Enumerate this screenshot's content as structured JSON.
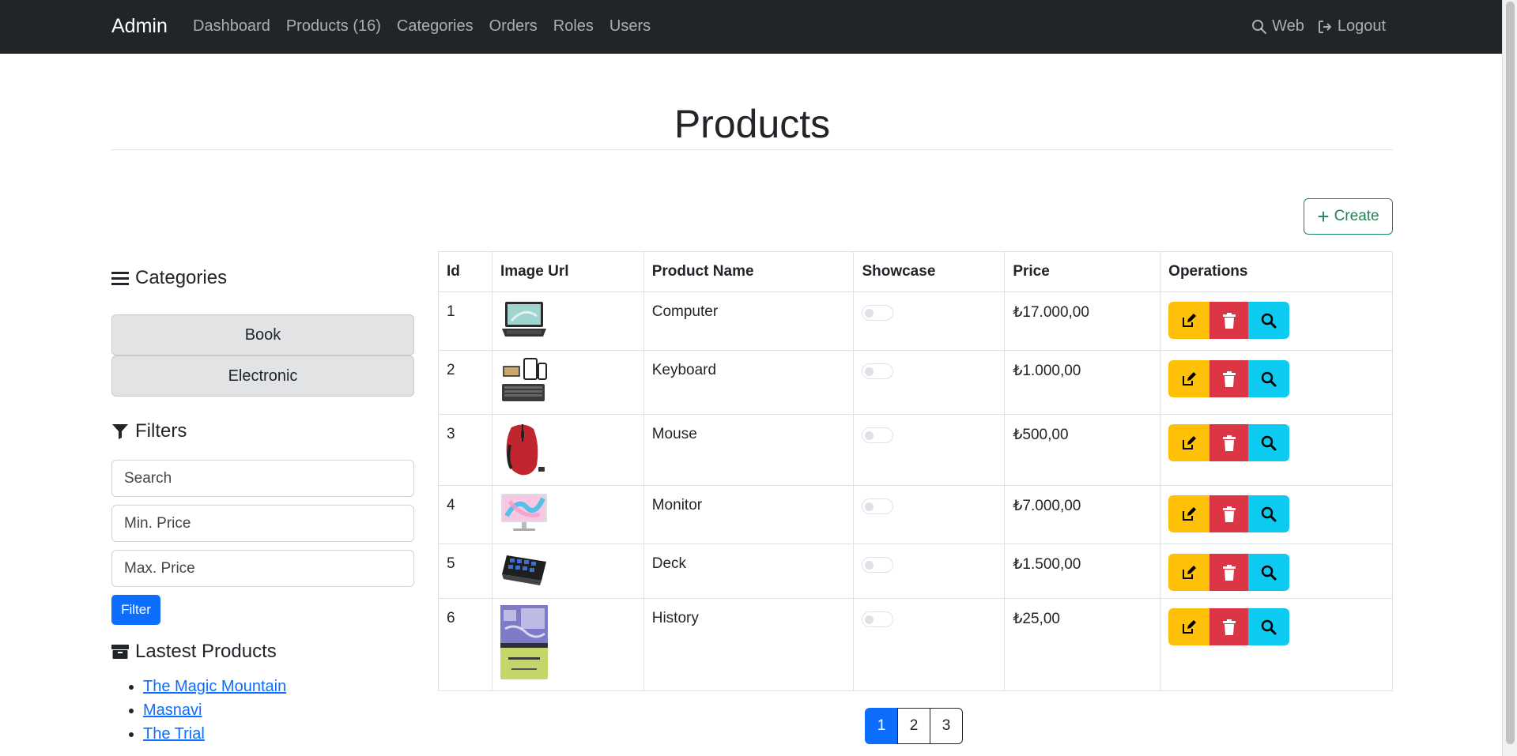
{
  "navbar": {
    "brand": "Admin",
    "links": [
      "Dashboard",
      "Products (16)",
      "Categories",
      "Orders",
      "Roles",
      "Users"
    ],
    "web_label": "Web",
    "logout_label": "Logout"
  },
  "page": {
    "title": "Products",
    "create_label": "Create"
  },
  "sidebar": {
    "categories_heading": "Categories",
    "categories": [
      "Book",
      "Electronic"
    ],
    "filters_heading": "Filters",
    "search_placeholder": "Search",
    "min_price_placeholder": "Min. Price",
    "max_price_placeholder": "Max. Price",
    "filter_button": "Filter",
    "latest_heading": "Lastest Products",
    "latest_products": [
      "The Magic Mountain",
      "Masnavi",
      "The Trial"
    ]
  },
  "table": {
    "headers": [
      "Id",
      "Image Url",
      "Product Name",
      "Showcase",
      "Price",
      "Operations"
    ],
    "rows": [
      {
        "id": "1",
        "name": "Computer",
        "showcase": false,
        "price": "₺17.000,00",
        "image": "laptop"
      },
      {
        "id": "2",
        "name": "Keyboard",
        "showcase": false,
        "price": "₺1.000,00",
        "image": "keyboard"
      },
      {
        "id": "3",
        "name": "Mouse",
        "showcase": false,
        "price": "₺500,00",
        "image": "mouse"
      },
      {
        "id": "4",
        "name": "Monitor",
        "showcase": false,
        "price": "₺7.000,00",
        "image": "monitor"
      },
      {
        "id": "5",
        "name": "Deck",
        "showcase": false,
        "price": "₺1.500,00",
        "image": "deck"
      },
      {
        "id": "6",
        "name": "History",
        "showcase": false,
        "price": "₺25,00",
        "image": "book-cover"
      }
    ]
  },
  "pagination": {
    "pages": [
      "1",
      "2",
      "3"
    ],
    "active": "1"
  },
  "colors": {
    "navbar_bg": "#212529",
    "primary": "#0d6efd",
    "success": "#198754",
    "warning": "#ffc107",
    "danger": "#dc3545",
    "info": "#0dcaf0"
  }
}
